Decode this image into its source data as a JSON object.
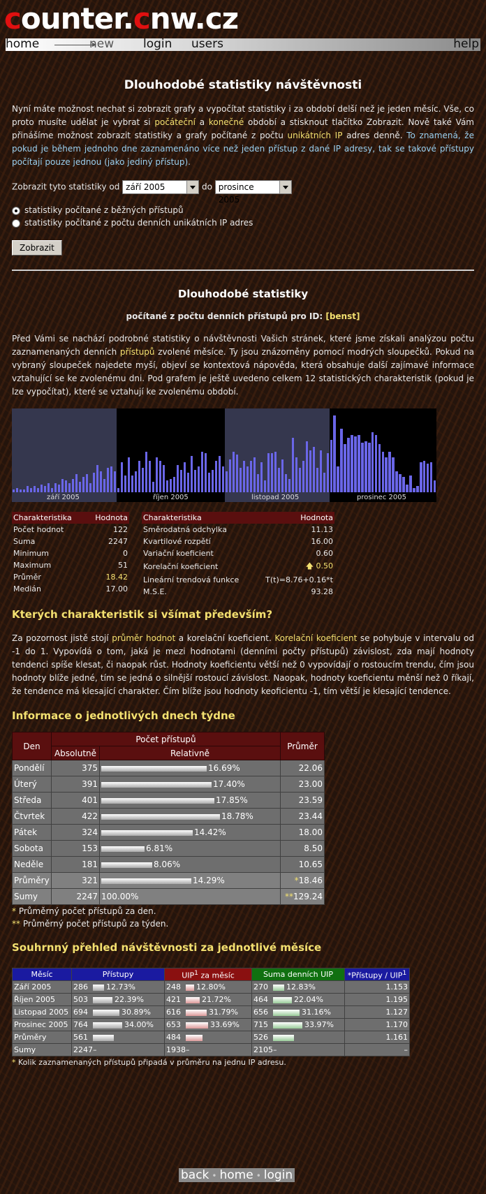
{
  "site": {
    "logo_c": "c",
    "logo_1": "ounter.",
    "logo_c2": "c",
    "logo_2": "nw.cz"
  },
  "menu": {
    "home": "home",
    "new": "new",
    "login": "login",
    "users": "users",
    "help": "help"
  },
  "title": "Dlouhodobé statistiky návštěvnosti",
  "intro": {
    "t1": "Nyní máte možnost nechat si zobrazit grafy a vypočítat statistiky i za období delší než je jeden měsíc. Vše, co proto musíte udělat je vybrat si ",
    "h1": "počáteční",
    "t2": " a ",
    "h2": "konečné",
    "t3": " období a stisknout tlačítko Zobrazit. Nově také Vám přinášíme možnost zobrazit statistiky a grafy počítané z počtu ",
    "h3": "unikátních IP",
    "t4": " adres denně. ",
    "b1": "To znamená, že pokud je během jednoho dne zaznamenáno více než jeden přístup z dané IP adresy, tak se takové přístupy počítají pouze jednou (jako jediný přístup)."
  },
  "form": {
    "label_from": "Zobrazit tyto statistiky od",
    "from": "září 2005",
    "label_to": "do",
    "to": "prosince 2005",
    "radio1": "statistiky počítané z běžných přístupů",
    "radio2": "statistiky počítané z počtu denních unikátních IP adres",
    "submit": "Zobrazit"
  },
  "section": {
    "title": "Dlouhodobé statistiky",
    "subtitle": "počítané z počtu denních přístupů pro ID: ",
    "id": "[benst]",
    "p_t1": "Před Vámi se nachází podrobné statistiky o návštěvnosti Vašich stránek, které jsme získali analýzou počtu zaznamenaných denních ",
    "p_h1": "přístupů",
    "p_t2": " zvolené měsíce. Ty jsou znázorněny pomocí modrých sloupečků. Pokud na vybraný sloupeček najedete myší, objeví se kontextová nápověda, která obsahuje další zajímavé informace vztahující se ke zvolenému dni. Pod grafem je ještě uvedeno celkem 12 statistických charakteristik (pokud je lze vypočítat), které se vztahují ke zvolenému období."
  },
  "chart_data": {
    "type": "bar",
    "categories": [
      "září 2005",
      "říjen 2005",
      "listopad 2005",
      "prosinec 2005"
    ],
    "series": [
      {
        "values": [
          2,
          3,
          2,
          2,
          4,
          3,
          4,
          3,
          5,
          4,
          6,
          3,
          6,
          5,
          9,
          8,
          6,
          9,
          12,
          7,
          10,
          12,
          6,
          13,
          18,
          14,
          9,
          16,
          17,
          14
        ]
      },
      {
        "values": [
          3,
          20,
          11,
          23,
          11,
          14,
          21,
          16,
          27,
          21,
          7,
          23,
          21,
          18,
          8,
          9,
          10,
          18,
          15,
          20,
          13,
          24,
          15,
          17,
          27,
          26,
          13,
          15,
          21,
          24,
          17
        ]
      },
      {
        "values": [
          14,
          22,
          27,
          25,
          16,
          21,
          17,
          21,
          23,
          12,
          20,
          8,
          26,
          26,
          27,
          16,
          22,
          12,
          9,
          36,
          23,
          16,
          21,
          34,
          28,
          30,
          16,
          28,
          13,
          26
        ]
      },
      {
        "values": [
          35,
          51,
          17,
          42,
          32,
          36,
          38,
          37,
          38,
          33,
          34,
          33,
          40,
          38,
          32,
          27,
          23,
          27,
          23,
          14,
          12,
          10,
          5,
          11,
          3,
          4,
          20,
          21,
          19,
          20,
          8
        ]
      }
    ],
    "ylim": [
      0,
      51
    ]
  },
  "stats_left": {
    "h1": "Charakteristika",
    "h2": "Hodnota",
    "rows": [
      {
        "k": "Počet hodnot",
        "v": "122"
      },
      {
        "k": "Suma",
        "v": "2247"
      },
      {
        "k": "Minimum",
        "v": "0"
      },
      {
        "k": "Maximum",
        "v": "51"
      },
      {
        "k": "Průměr",
        "v": "18.42"
      },
      {
        "k": "Medián",
        "v": "17.00"
      }
    ]
  },
  "stats_right": {
    "h1": "Charakteristika",
    "h2": "Hodnota",
    "rows": [
      {
        "k": "Směrodatná odchylka",
        "v": "11.13"
      },
      {
        "k": "Kvartilové rozpětí",
        "v": "16.00"
      },
      {
        "k": "Variační koeficient",
        "v": "0.60"
      },
      {
        "k": "Korelační koeficient",
        "v": "0.50"
      },
      {
        "k": "Lineární trendová funkce",
        "v": "T(t)=8.76+0.16*t"
      },
      {
        "k": "M.S.E.",
        "v": "93.28"
      }
    ]
  },
  "which": {
    "title": "Kterých charakteristik si všímat především?",
    "t1": "Za pozornost jistě stojí ",
    "h1": "průměr hodnot",
    "t2": " a korelační koeficient. ",
    "h2": "Korelační koeficient",
    "t3": " se pohybuje v intervalu od -1 do 1. Vypovídá o tom, jaká je mezi hodnotami (denními počty přístupů) závislost, zda mají hodnoty tendenci spíše klesat, či naopak růst. Hodnoty koeficientu větší než 0 vypovídají o rostoucím trendu, čím jsou hodnoty blíže jedné, tím se jedná o silnější rostoucí závislost. Naopak, hodnoty koeficientu měnší než 0 říkají, že tendence má klesající charakter. Čím blíže jsou hodnoty keoficientu -1, tím větší je klesající tendence."
  },
  "week": {
    "title": "Informace o jednotlivých dnech týdne",
    "h_den": "Den",
    "h_pocet": "Počet přístupů",
    "h_abs": "Absolutně",
    "h_rel": "Relativně",
    "h_prum": "Průměr",
    "rows": [
      {
        "den": "Pondělí",
        "abs": "375",
        "rel": "16.69%",
        "relv": 16.69,
        "prum": "22.06"
      },
      {
        "den": "Úterý",
        "abs": "391",
        "rel": "17.40%",
        "relv": 17.4,
        "prum": "23.00"
      },
      {
        "den": "Středa",
        "abs": "401",
        "rel": "17.85%",
        "relv": 17.85,
        "prum": "23.59"
      },
      {
        "den": "Čtvrtek",
        "abs": "422",
        "rel": "18.78%",
        "relv": 18.78,
        "prum": "23.44"
      },
      {
        "den": "Pátek",
        "abs": "324",
        "rel": "14.42%",
        "relv": 14.42,
        "prum": "18.00"
      },
      {
        "den": "Sobota",
        "abs": "153",
        "rel": "6.81%",
        "relv": 6.81,
        "prum": "8.50"
      },
      {
        "den": "Neděle",
        "abs": "181",
        "rel": "8.06%",
        "relv": 8.06,
        "prum": "10.65"
      }
    ],
    "avg": {
      "den": "Průměry",
      "abs": "321",
      "rel": "14.29%",
      "relv": 14.29,
      "star": "*",
      "prum": "18.46"
    },
    "sum": {
      "den": "Sumy",
      "abs": "2247",
      "rel": "100.00%",
      "star": "**",
      "prum": "129.24"
    },
    "note1_star": "*",
    "note1": " Průměrný počet přístupů za den.",
    "note2_star": "**",
    "note2": " Průměrný počet přístupů za týden."
  },
  "months": {
    "title": "Souhrnný přehled návštěvnosti za jednotlivé měsíce",
    "h_mesic": "Měsíc",
    "h_pristupy": "Přístupy",
    "h_uip": "UIP",
    "h_uip_sup": "1",
    "h_uip_tail": " za měsíc",
    "h_suma": "Suma denních UIP",
    "h_ratio": "*Přístupy / UIP",
    "h_ratio_sup": "1",
    "col_colors": {
      "mesic": "#1a1aa0",
      "pristupy": "#1a1aa0",
      "uip": "#8a1010",
      "suma": "#107010",
      "ratio": "#1a1aa0"
    },
    "rows": [
      {
        "m": "Září 2005",
        "p": "286",
        "pp": "12.73%",
        "pv": 12.73,
        "u": "248",
        "up": "12.80%",
        "uv": 12.8,
        "s": "270",
        "sp": "12.83%",
        "sv": 12.83,
        "r": "1.153"
      },
      {
        "m": "Říjen 2005",
        "p": "503",
        "pp": "22.39%",
        "pv": 22.39,
        "u": "421",
        "up": "21.72%",
        "uv": 21.72,
        "s": "464",
        "sp": "22.04%",
        "sv": 22.04,
        "r": "1.195"
      },
      {
        "m": "Listopad 2005",
        "p": "694",
        "pp": "30.89%",
        "pv": 30.89,
        "u": "616",
        "up": "31.79%",
        "uv": 31.79,
        "s": "656",
        "sp": "31.16%",
        "sv": 31.16,
        "r": "1.127"
      },
      {
        "m": "Prosinec 2005",
        "p": "764",
        "pp": "34.00%",
        "pv": 34.0,
        "u": "653",
        "up": "33.69%",
        "uv": 33.69,
        "s": "715",
        "sp": "33.97%",
        "sv": 33.97,
        "r": "1.170"
      }
    ],
    "avg": {
      "m": "Průměry",
      "p": "561",
      "u": "484",
      "s": "526",
      "r": "1.161"
    },
    "sum": {
      "m": "Sumy",
      "p": "2247",
      "pd": "–",
      "u": "1938",
      "ud": "–",
      "s": "2105",
      "sd": "–",
      "r": "–"
    },
    "note_star": "*",
    "note": " Kolik zaznamenaných přístupů připadá v průměru na jednu IP adresu."
  },
  "footer": {
    "back": "back",
    "home": "home",
    "login": "login"
  }
}
